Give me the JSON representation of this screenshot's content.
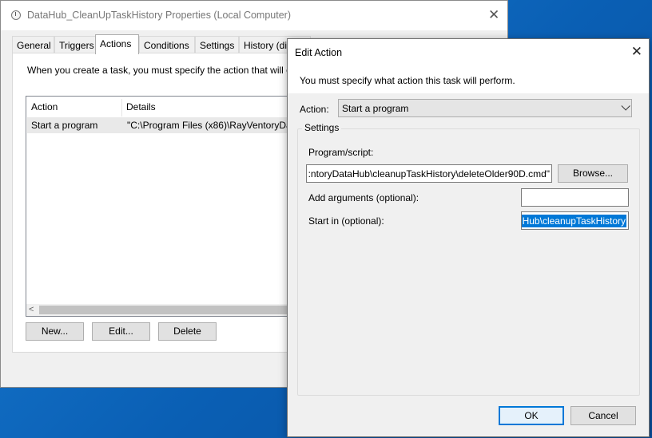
{
  "props_window": {
    "title": "DataHub_CleanUpTaskHistory Properties (Local Computer)",
    "close": "✕",
    "tabs": [
      "General",
      "Triggers",
      "Actions",
      "Conditions",
      "Settings",
      "History (di"
    ],
    "description": "When you create a task, you must specify the action that will o",
    "columns": [
      "Action",
      "Details"
    ],
    "row": {
      "action": "Start a program",
      "details": "\"C:\\Program Files (x86)\\RayVentoryDat"
    },
    "scroll_left": "<",
    "buttons": {
      "new": "New...",
      "edit": "Edit...",
      "delete": "Delete"
    }
  },
  "edit_dialog": {
    "title": "Edit Action",
    "close": "✕",
    "message": "You must specify what action this task will perform.",
    "action_label": "Action:",
    "action_value": "Start a program",
    "settings_label": "Settings",
    "program_label": "Program/script:",
    "program_value": ":ntoryDataHub\\cleanupTaskHistory\\deleteOlder90D.cmd\"",
    "browse": "Browse...",
    "args_label": "Add arguments (optional):",
    "args_value": "",
    "startin_label": "Start in (optional):",
    "startin_value": "Hub\\cleanupTaskHistory",
    "ok": "OK",
    "cancel": "Cancel"
  }
}
